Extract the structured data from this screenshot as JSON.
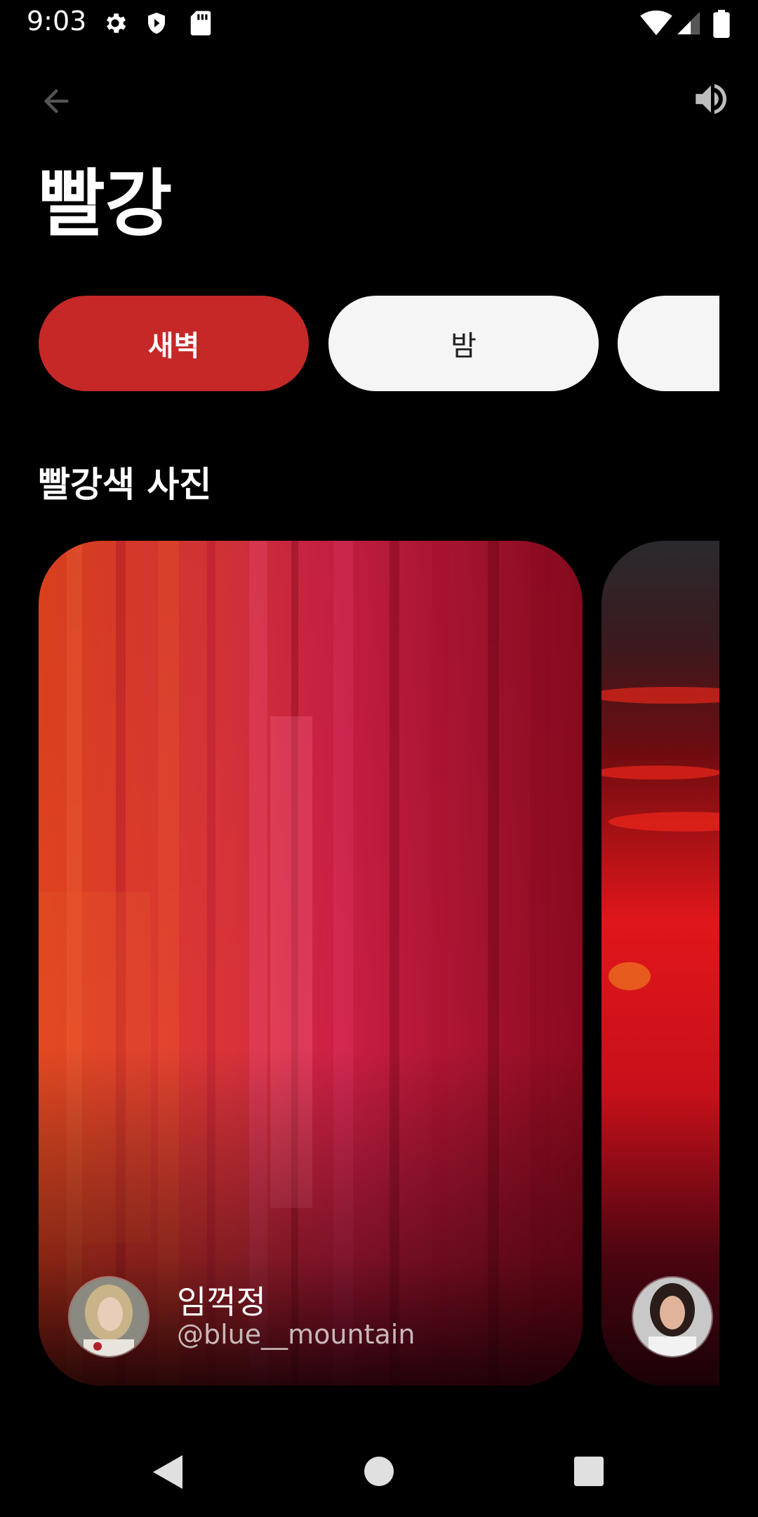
{
  "status_bar": {
    "time": "9:03",
    "left_icons": [
      "gear-icon",
      "shield-icon",
      "sd-card-icon"
    ],
    "right_icons": [
      "wifi-icon",
      "signal-icon",
      "battery-icon"
    ]
  },
  "header": {
    "title": "빨강",
    "back_icon": "arrow-back-icon",
    "volume_icon": "volume-icon"
  },
  "chips": [
    {
      "label": "새벽",
      "active": true
    },
    {
      "label": "밤",
      "active": false
    },
    {
      "label": "",
      "active": false
    }
  ],
  "section": {
    "title": "빨강색 사진"
  },
  "cards": [
    {
      "author_name": "임꺽정",
      "author_handle": "@blue__mountain"
    },
    {
      "author_name": "",
      "author_handle": ""
    }
  ],
  "nav_bar": {
    "icons": [
      "back-triangle-icon",
      "home-circle-icon",
      "recents-square-icon"
    ]
  },
  "colors": {
    "accent": "#c62828",
    "chip_inactive": "#f5f5f5",
    "background": "#000000"
  }
}
